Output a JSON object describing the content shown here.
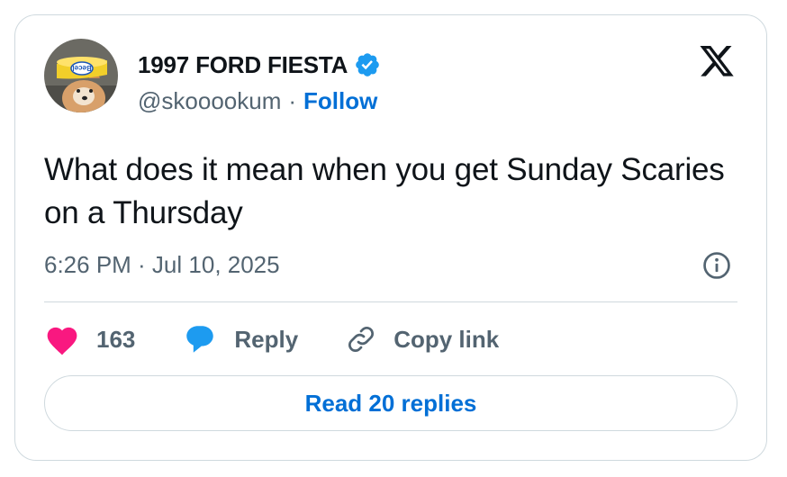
{
  "author": {
    "display_name": "1997 FORD FIESTA",
    "handle": "@skooookum",
    "separator": "·",
    "follow_label": "Follow",
    "avatar_label": "Becel",
    "verified_icon": "verified-badge-icon"
  },
  "tweet": {
    "text": "What does it mean when you get Sunday Scaries on a Thursday",
    "timestamp": "6:26 PM · Jul 10, 2025"
  },
  "actions": {
    "like_count": "163",
    "reply_label": "Reply",
    "copy_link_label": "Copy link"
  },
  "read_replies_label": "Read 20 replies",
  "icons": {
    "brand": "x-logo-icon",
    "info": "info-icon",
    "like": "heart-icon",
    "reply": "speech-bubble-icon",
    "copy": "link-icon"
  },
  "colors": {
    "accent": "#006fd6",
    "verified": "#1d9bf0",
    "like": "#f91880",
    "muted": "#536471",
    "border": "#cfd9de"
  }
}
